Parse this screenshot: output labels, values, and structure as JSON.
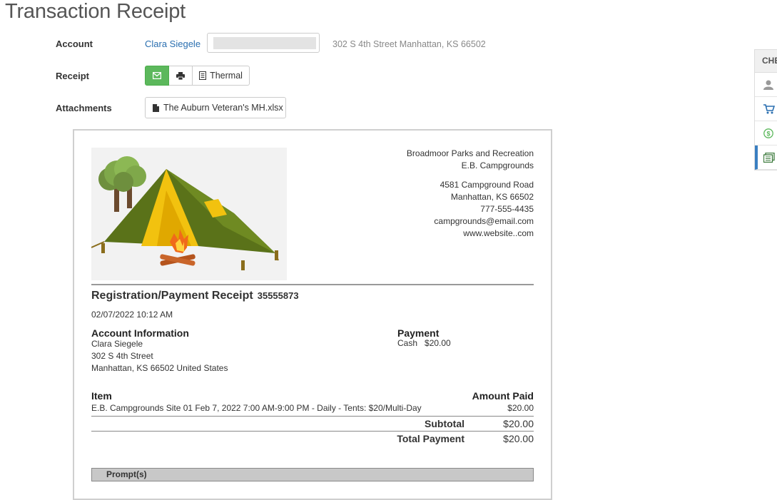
{
  "page": {
    "title": "Transaction Receipt"
  },
  "account": {
    "label": "Account",
    "name": "Clara Siegele",
    "address": "302 S 4th Street Manhattan, KS 66502"
  },
  "receipt_options": {
    "label": "Receipt",
    "thermal_label": "Thermal"
  },
  "attachments": {
    "label": "Attachments",
    "file_name": "The Auburn Veteran's MH.xlsx"
  },
  "receipt": {
    "org_name": "Broadmoor Parks and Recreation",
    "facility": "E.B. Campgrounds",
    "street": "4581 Campground Road",
    "city": "Manhattan, KS 66502",
    "phone": "777-555-4435",
    "email": "campgrounds@email.com",
    "website": "www.website..com",
    "title": "Registration/Payment Receipt",
    "number": "35555873",
    "date": "02/07/2022 10:12 AM",
    "account_info_heading": "Account Information",
    "account_name": "Clara Siegele",
    "account_street": "302 S 4th Street",
    "account_city": "Manhattan, KS 66502 United States",
    "payment_heading": "Payment",
    "payment_line": "Cash   $20.00",
    "item_heading": "Item",
    "amount_heading": "Amount Paid",
    "item_description": "E.B. Campgrounds Site 01 Feb 7, 2022 7:00 AM-9:00 PM - Daily - Tents: $20/Multi-Day",
    "item_amount": "$20.00",
    "subtotal_label": "Subtotal",
    "subtotal_value": "$20.00",
    "total_label": "Total Payment",
    "total_value": "$20.00",
    "prompts_label": "Prompt(s)"
  },
  "side_panel": {
    "heading": "CHE",
    "icons": [
      "user-icon",
      "cart-icon",
      "dollar-icon",
      "receipt-icon"
    ]
  },
  "colors": {
    "accent_green": "#5cb85c",
    "link_blue": "#2a6fb0",
    "active_blue": "#3a7fc1"
  }
}
